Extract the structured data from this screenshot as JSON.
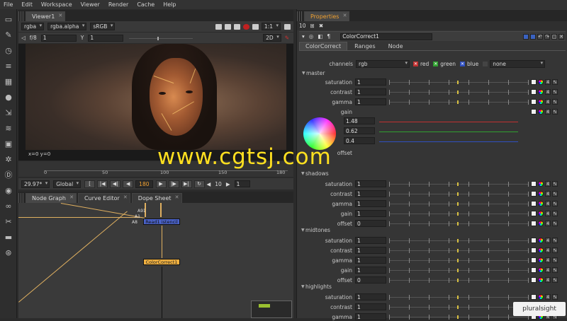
{
  "menu": [
    "File",
    "Edit",
    "Workspace",
    "Viewer",
    "Render",
    "Cache",
    "Help"
  ],
  "viewer": {
    "tab": "Viewer1",
    "channels": "rgba",
    "alpha": "rgba.alpha",
    "colorspace": "sRGB",
    "zoom": "1:1",
    "fstop": "f/8",
    "gain_val": "1",
    "y_label": "Y",
    "gamma_val": "1",
    "view_mode": "2D",
    "coords": "x=0 y=0"
  },
  "timeline": {
    "ticks": [
      "0",
      "50",
      "100",
      "150",
      "180"
    ],
    "fps": "29.97*",
    "scope": "Global",
    "current_frame": "180",
    "step": "10",
    "end_frame": "1"
  },
  "graph_tabs": [
    "Node Graph",
    "Curve Editor",
    "Dope Sheet"
  ],
  "nodes": {
    "read": "Read1 istencil",
    "cc": "ColorCorrect1",
    "inputs": [
      "A91",
      "A1",
      "A8"
    ]
  },
  "properties": {
    "tab": "Properties",
    "count": "10",
    "node_name": "ColorCorrect1",
    "tabs": [
      "ColorCorrect",
      "Ranges",
      "Node"
    ],
    "channels_label": "channels",
    "channels_value": "rgb",
    "ch_red": "red",
    "ch_green": "green",
    "ch_blue": "blue",
    "ch_none": "none",
    "master": "master",
    "master_rows": [
      {
        "label": "saturation",
        "value": "1"
      },
      {
        "label": "contrast",
        "value": "1"
      },
      {
        "label": "gamma",
        "value": "1"
      },
      {
        "label": "gain",
        "value": ""
      }
    ],
    "gain_rgb": [
      "1.48",
      "0.62",
      "0.4"
    ],
    "offset_label": "offset",
    "shadows": "shadows",
    "shadows_rows": [
      {
        "label": "saturation",
        "value": "1"
      },
      {
        "label": "contrast",
        "value": "1"
      },
      {
        "label": "gamma",
        "value": "1"
      },
      {
        "label": "gain",
        "value": "1"
      },
      {
        "label": "offset",
        "value": "0"
      }
    ],
    "midtones": "midtones",
    "midtones_rows": [
      {
        "label": "saturation",
        "value": "1"
      },
      {
        "label": "contrast",
        "value": "1"
      },
      {
        "label": "gamma",
        "value": "1"
      },
      {
        "label": "gain",
        "value": "1"
      },
      {
        "label": "offset",
        "value": "0"
      }
    ],
    "highlights": "highlights",
    "highlights_rows": [
      {
        "label": "saturation",
        "value": "1"
      },
      {
        "label": "contrast",
        "value": "1"
      },
      {
        "label": "gamma",
        "value": "1"
      }
    ],
    "anim_count": "4"
  },
  "watermark": "www.cgtsj.com",
  "brand": "pluralsight"
}
